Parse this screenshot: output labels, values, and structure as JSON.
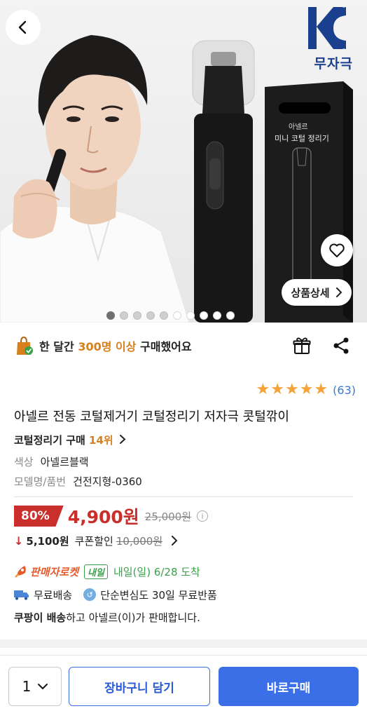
{
  "hero": {
    "kc_mark_text": "무자극",
    "box_brand": "아넬르",
    "box_product": "미니 코털 정리기",
    "detail_button_label": "상품상세",
    "slide_count": 10,
    "active_slide": 1
  },
  "social": {
    "prefix": "한 달간 ",
    "highlight": "300명 이상",
    "suffix": " 구매했어요"
  },
  "rating": {
    "stars": 5,
    "count_text": "(63)"
  },
  "product": {
    "title": "아넬르 전동 코털제거기 코털정리기 저자극 콧털깎이",
    "rank_prefix": "코털정리기 구매 ",
    "rank_value": "14위",
    "options": [
      {
        "label": "색상",
        "value": "아넬르블랙"
      },
      {
        "label": "모델명/품번",
        "value": "건전지형-0360"
      }
    ]
  },
  "price": {
    "discount_rate": "80%",
    "sale_price": "4,900원",
    "original_price": "25,000원",
    "info_icon": "i"
  },
  "coupon": {
    "arrow": "↓",
    "price": "5,100원",
    "label": "쿠폰할인",
    "original": "10,000원"
  },
  "delivery": {
    "rocket_label": "판매자로켓",
    "tomorrow_badge": "내일",
    "arrival_text": "내일(일) 6/28 도착",
    "free_shipping": "무료배송",
    "return_policy": "단순변심도 30일 무료반품",
    "seller_bold": "쿠팡이 배송",
    "seller_rest": "하고 아넬르(이)가 판매합니다."
  },
  "bottom": {
    "quantity": "1",
    "cart_label": "장바구니 담기",
    "buy_label": "바로구매"
  },
  "colors": {
    "accent_blue": "#3a6fe8",
    "discount_red": "#c9302c",
    "highlight_orange": "#d8801e",
    "rocket_green": "#3aa04a",
    "star": "#f5a338"
  }
}
